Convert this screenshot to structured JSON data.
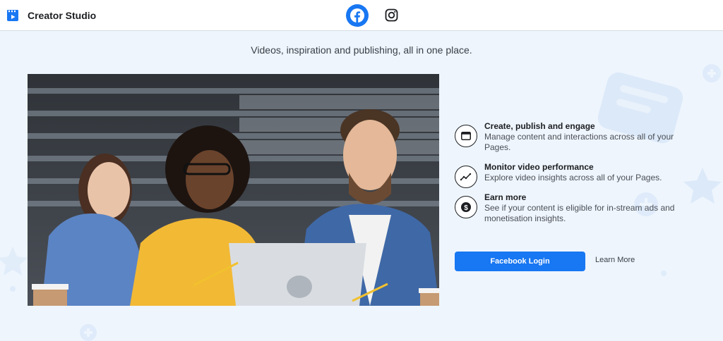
{
  "app": {
    "title": "Creator Studio"
  },
  "platforms": [
    {
      "name": "facebook",
      "icon": "facebook-icon",
      "active": true
    },
    {
      "name": "instagram",
      "icon": "instagram-icon",
      "active": false
    }
  ],
  "tagline": "Videos, inspiration and publishing, all in one place.",
  "features": [
    {
      "icon": "dashboard-icon",
      "title": "Create, publish and engage",
      "description": "Manage content and interactions across all of your Pages."
    },
    {
      "icon": "chart-line-icon",
      "title": "Monitor video performance",
      "description": "Explore video insights across all of your Pages."
    },
    {
      "icon": "dollar-icon",
      "title": "Earn more",
      "description": "See if your content is eligible for in-stream ads and monetisation insights."
    }
  ],
  "actions": {
    "login_label": "Facebook Login",
    "learn_more_label": "Learn More"
  },
  "colors": {
    "accent": "#1877f2",
    "background": "#eef5fd",
    "topbar": "#ffffff"
  }
}
